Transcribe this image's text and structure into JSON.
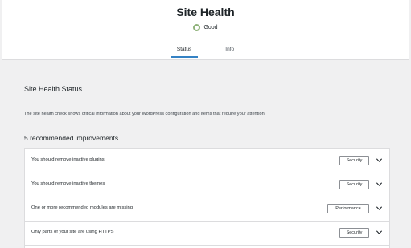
{
  "header": {
    "title": "Site Health",
    "status": "Good",
    "tabs": [
      {
        "label": "Status",
        "active": true
      },
      {
        "label": "Info",
        "active": false
      }
    ]
  },
  "main": {
    "section_title": "Site Health Status",
    "description": "The site health check shows critical information about your WordPress configuration and items that require your attention.",
    "improvements_heading": "5 recommended improvements",
    "issues": [
      {
        "text": "You should remove inactive plugins",
        "badge": "Security"
      },
      {
        "text": "You should remove inactive themes",
        "badge": "Security"
      },
      {
        "text": "One or more recommended modules are missing",
        "badge": "Performance"
      },
      {
        "text": "Only parts of your site are using HTTPS",
        "badge": "Security"
      }
    ]
  },
  "colors": {
    "accent": "#3582c4",
    "good_ring": "#8fb27a",
    "page_bg": "#f0f0f1"
  },
  "icons": {
    "status": "circle-ring-icon",
    "expand": "chevron-down-icon"
  }
}
